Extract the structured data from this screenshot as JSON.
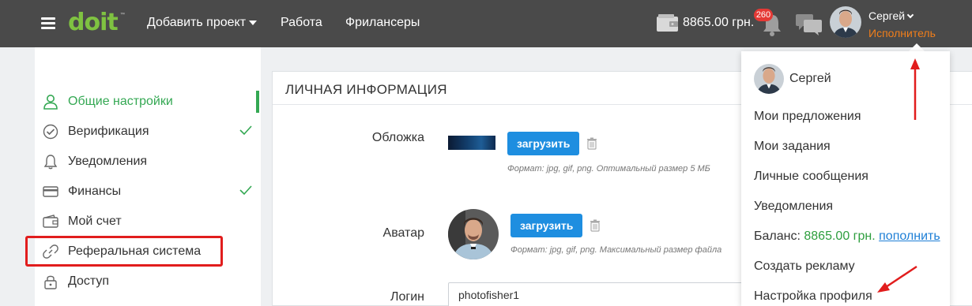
{
  "header": {
    "logo": "doit",
    "nav": [
      {
        "label": "Добавить проект",
        "has_caret": true
      },
      {
        "label": "Работа"
      },
      {
        "label": "Фрилансеры"
      }
    ],
    "balance": "8865.00 грн.",
    "notifications_count": "260",
    "user": {
      "name": "Сергей",
      "role": "Исполнитель"
    }
  },
  "sidebar": {
    "items": [
      {
        "label": "Общие настройки",
        "icon": "user-icon",
        "active": true
      },
      {
        "label": "Верификация",
        "icon": "check-circle-icon",
        "check": true
      },
      {
        "label": "Уведомления",
        "icon": "bell-icon"
      },
      {
        "label": "Финансы",
        "icon": "card-icon",
        "check": true
      },
      {
        "label": "Мой счет",
        "icon": "wallet-icon"
      },
      {
        "label": "Реферальная система",
        "icon": "link-icon",
        "highlighted": true
      },
      {
        "label": "Доступ",
        "icon": "lock-icon"
      }
    ]
  },
  "main": {
    "title": "ЛИЧНАЯ ИНФОРМАЦИЯ",
    "cover": {
      "label": "Обложка",
      "button": "загрузить",
      "hint": "Формат: jpg, gif, png. Оптимальный размер 5 МБ"
    },
    "avatar": {
      "label": "Аватар",
      "button": "загрузить",
      "hint": "Формат: jpg, gif, png. Максимальный размер файла"
    },
    "login": {
      "label": "Логин",
      "value": "photofisher1"
    }
  },
  "dropdown": {
    "name": "Сергей",
    "items": [
      "Мои предложения",
      "Мои задания",
      "Личные сообщения",
      "Уведомления"
    ],
    "balance_label": "Баланс:",
    "balance_value": "8865.00 грн.",
    "topup": "пополнить",
    "create_ad": "Создать рекламу",
    "profile_settings": "Настройка профиля"
  },
  "colors": {
    "topbar": "#4a4a4a",
    "brand_green": "#7fc241",
    "active_green": "#34a853",
    "role_orange": "#f07e1b",
    "button_blue": "#1e8ee0",
    "annotation_red": "#e11d1d"
  }
}
